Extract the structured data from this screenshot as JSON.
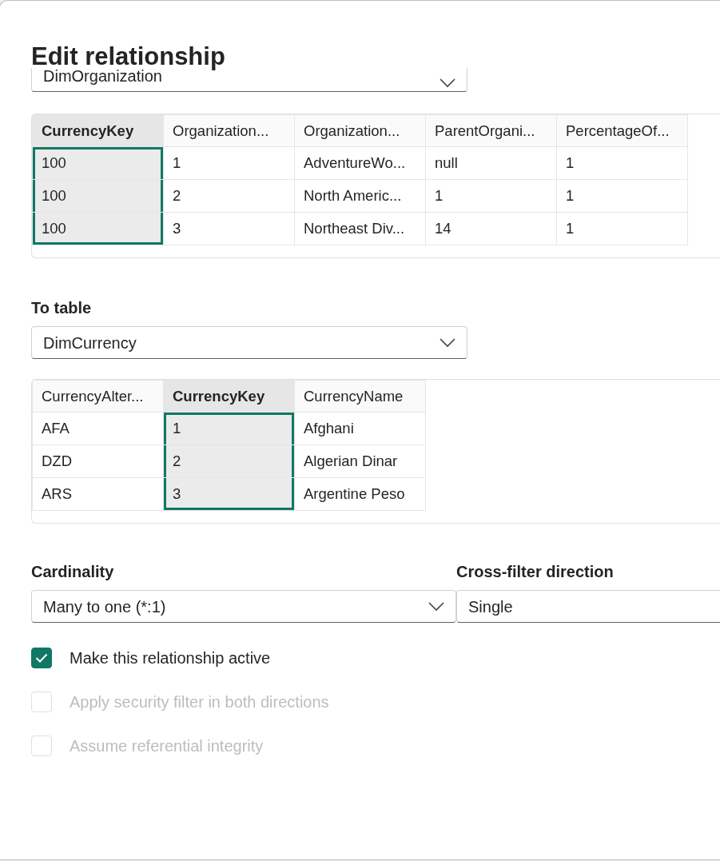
{
  "dialog": {
    "title": "Edit relationship"
  },
  "from_table": {
    "dropdown": {
      "value": "DimOrganization"
    },
    "columns": [
      {
        "label": "CurrencyKey",
        "selected": true
      },
      {
        "label": "Organization...",
        "selected": false
      },
      {
        "label": "Organization...",
        "selected": false
      },
      {
        "label": "ParentOrgani...",
        "selected": false
      },
      {
        "label": "PercentageOf...",
        "selected": false
      }
    ],
    "rows": [
      [
        "100",
        "1",
        "AdventureWo...",
        "null",
        "1"
      ],
      [
        "100",
        "2",
        "North Americ...",
        "1",
        "1"
      ],
      [
        "100",
        "3",
        "Northeast Div...",
        "14",
        "1"
      ]
    ]
  },
  "to_table": {
    "label": "To table",
    "dropdown": {
      "value": "DimCurrency"
    },
    "columns": [
      {
        "label": "CurrencyAlter...",
        "selected": false
      },
      {
        "label": "CurrencyKey",
        "selected": true
      },
      {
        "label": "CurrencyName",
        "selected": false
      }
    ],
    "rows": [
      [
        "AFA",
        "1",
        "Afghani"
      ],
      [
        "DZD",
        "2",
        "Algerian Dinar"
      ],
      [
        "ARS",
        "3",
        "Argentine Peso"
      ]
    ]
  },
  "cardinality": {
    "label": "Cardinality",
    "value": "Many to one (*:1)"
  },
  "cross_filter": {
    "label": "Cross-filter direction",
    "value": "Single"
  },
  "options": [
    {
      "label": "Make this relationship active",
      "checked": true,
      "disabled": false
    },
    {
      "label": "Apply security filter in both directions",
      "checked": false,
      "disabled": true
    },
    {
      "label": "Assume referential integrity",
      "checked": false,
      "disabled": true
    }
  ]
}
